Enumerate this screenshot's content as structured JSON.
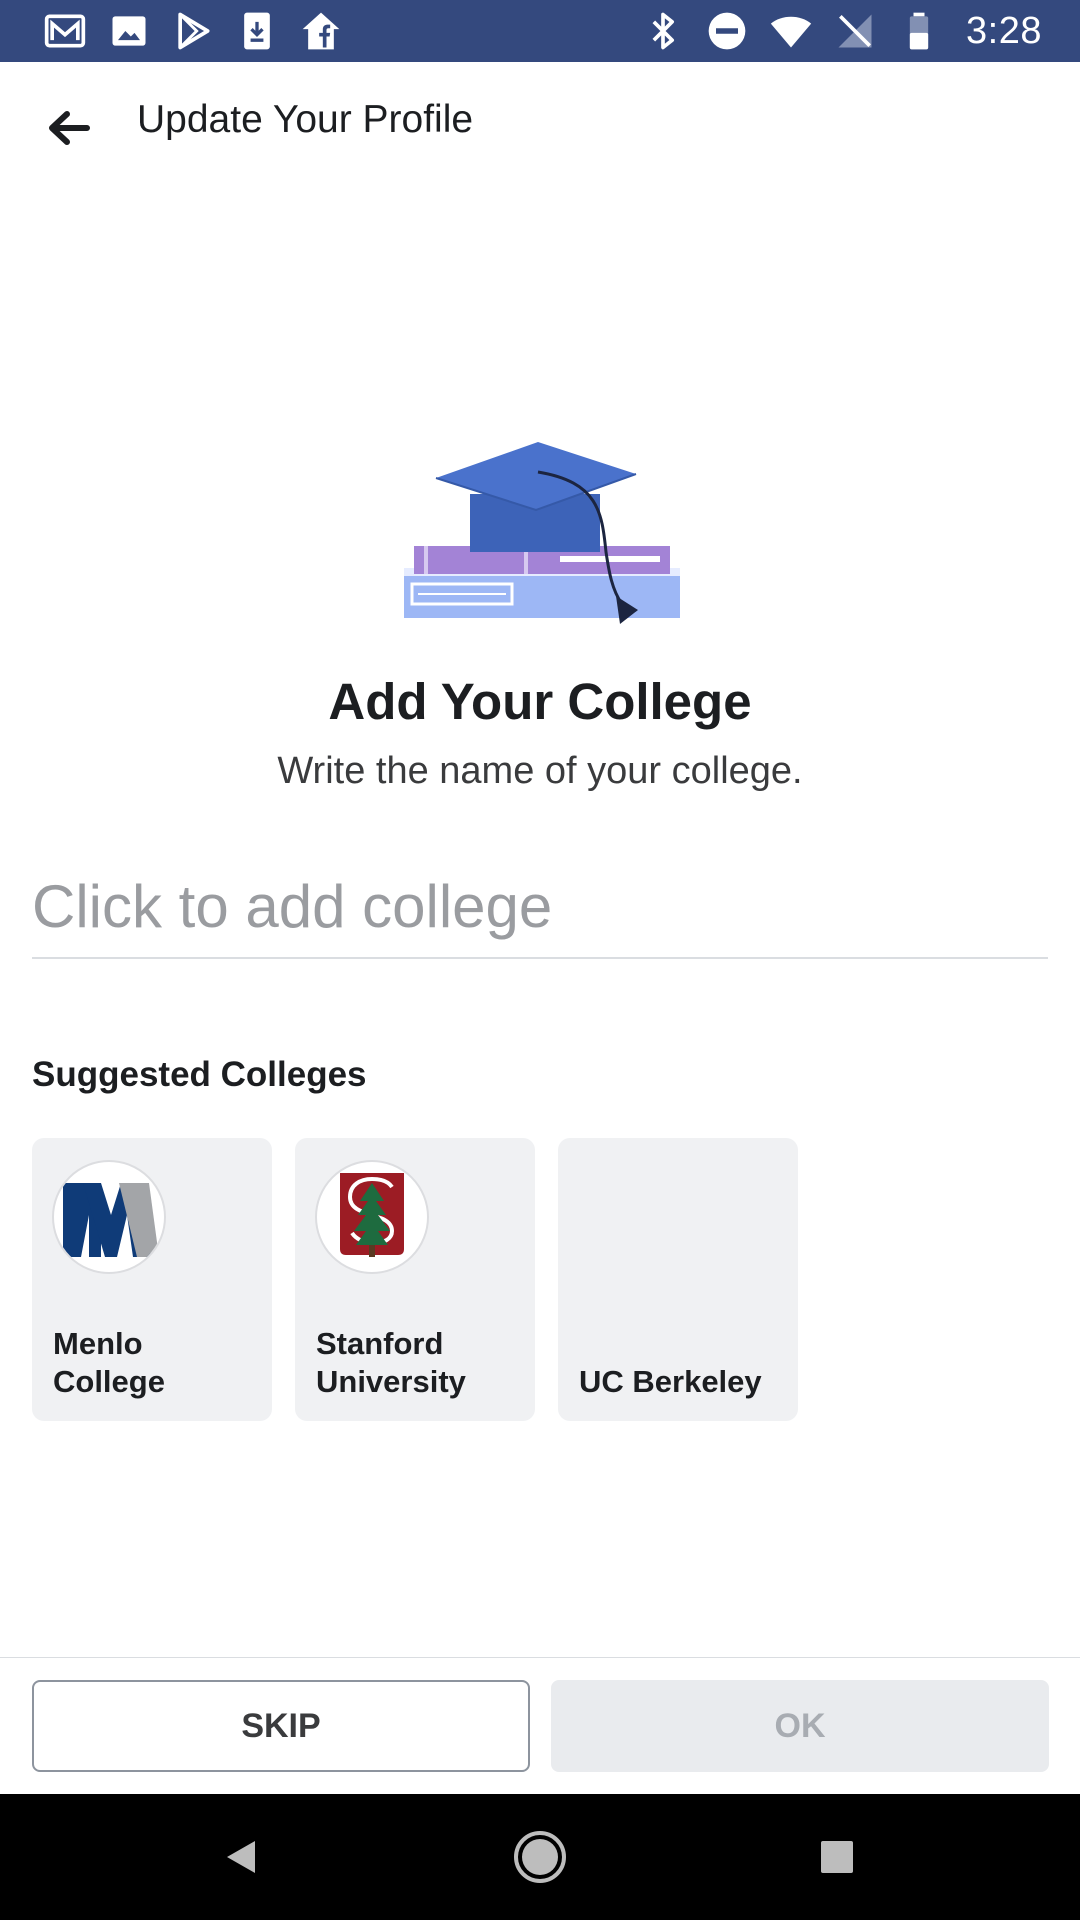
{
  "status_bar": {
    "time": "3:28",
    "left_icons": [
      "gmail-icon",
      "photos-icon",
      "play-store-icon",
      "download-icon",
      "facebook-home-icon"
    ],
    "right_icons": [
      "bluetooth-icon",
      "do-not-disturb-icon",
      "wifi-icon",
      "no-signal-icon",
      "battery-icon"
    ],
    "background_color": "#34497e"
  },
  "app_bar": {
    "title": "Update Your Profile"
  },
  "main": {
    "heading": "Add Your College",
    "subheading": "Write the name of your college.",
    "college_input": {
      "placeholder": "Click to add college",
      "value": ""
    },
    "suggested_title": "Suggested Colleges",
    "suggested_colleges": [
      {
        "name": "Menlo College",
        "logo": "menlo-logo"
      },
      {
        "name": "Stanford University",
        "logo": "stanford-logo"
      },
      {
        "name": "UC Berkeley",
        "logo": ""
      }
    ]
  },
  "actions": {
    "skip_label": "SKIP",
    "ok_label": "OK"
  },
  "nav_bar": {
    "items": [
      "back-nav-icon",
      "home-nav-icon",
      "recents-nav-icon"
    ]
  }
}
